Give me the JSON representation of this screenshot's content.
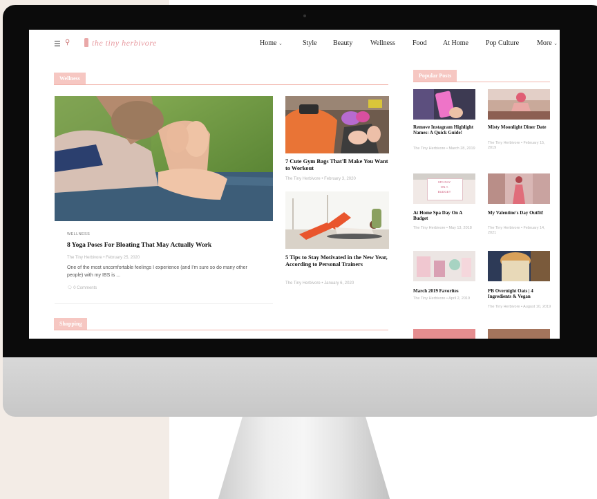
{
  "header": {
    "logo_text": "the tiny herbivore",
    "nav": [
      "Home",
      "Style",
      "Beauty",
      "Wellness",
      "Food",
      "At Home",
      "Pop Culture",
      "More"
    ],
    "home_caret": "⌄",
    "more_caret": "⌄"
  },
  "main": {
    "section_label": "Wellness",
    "feature": {
      "category": "WELLNESS",
      "title": "8 Yoga Poses For Bloating That May Actually Work",
      "meta": "The Tiny Herbivore • February 25, 2020",
      "excerpt": "One of the most uncomfortable feelings I experience (and I'm sure so do many other people) with my IBS is ...",
      "comments": "0 Comments"
    },
    "side_posts": [
      {
        "title": "7 Cute Gym Bags That'll Make You Want to Workout",
        "meta": "The Tiny Herbivore • February 3, 2020"
      },
      {
        "title": "5 Tips to Stay Motivated in the New Year, According to Personal Trainers",
        "meta": "The Tiny Herbivore • January 6, 2020"
      }
    ],
    "next_section_label": "Shopping"
  },
  "sidebar": {
    "label": "Popular Posts",
    "posts": [
      {
        "title": "Remove Instagram Highlight Names: A Quick Guide!",
        "meta": "The Tiny Herbivore • March 28, 2019"
      },
      {
        "title": "Misty Moonlight Diner Date",
        "meta": "The Tiny Herbivore • February 15, 2019"
      },
      {
        "title": "At Home Spa Day On A Budget",
        "meta": "The Tiny Herbivore • May 13, 2018"
      },
      {
        "title": "My Valentine's Day Outfit!",
        "meta": "The Tiny Herbivore • February 14, 2021"
      },
      {
        "title": "March 2019 Favorites",
        "meta": "The Tiny Herbivore • April 2, 2019"
      },
      {
        "title": "PB Overnight Oats | 4 Ingredients & Vegan",
        "meta": "The Tiny Herbivore • August 10, 2019"
      }
    ],
    "spa_image_text": [
      "SPA DAY",
      "ON A",
      "BUDGET"
    ]
  },
  "colors": {
    "accent_pink": "#f6c7c2",
    "accent_line": "#f2b5ad",
    "logo_pink": "#e79aa0"
  }
}
